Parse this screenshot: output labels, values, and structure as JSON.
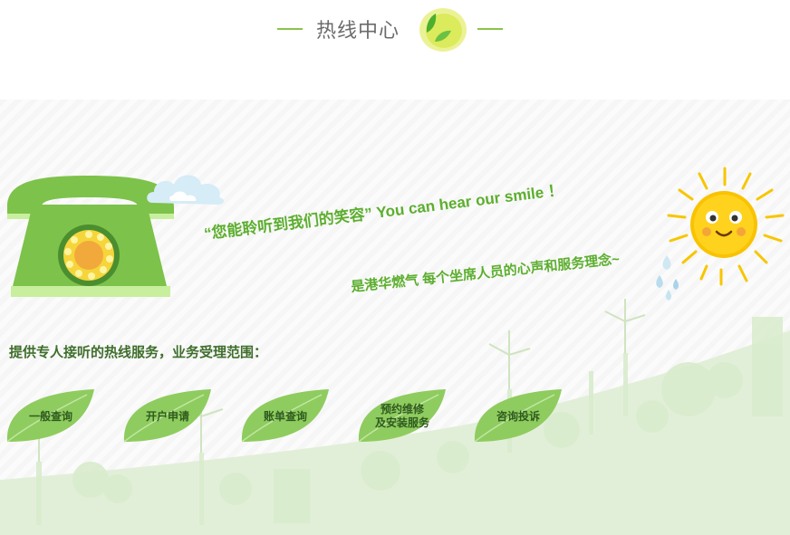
{
  "header": {
    "title": "热线中心"
  },
  "slogan": {
    "line1": "“您能聆听到我们的笑容” You can hear our smile ！",
    "line2": "是港华燃气 每个坐席人员的心声和服务理念~"
  },
  "intro": "提供专人接听的热线服务，业务受理范围：",
  "services": [
    {
      "line1": "一般查询",
      "line2": ""
    },
    {
      "line1": "开户申请",
      "line2": ""
    },
    {
      "line1": "账单查询",
      "line2": ""
    },
    {
      "line1": "预约维修",
      "line2": "及安装服务"
    },
    {
      "line1": "咨询投诉",
      "line2": ""
    }
  ],
  "colors": {
    "accent": "#8bc34a",
    "dark_green": "#3f6e2c",
    "leaf": "#8fcc5f",
    "sun": "#f7b500"
  },
  "icons": [
    "telephone-icon",
    "sun-icon",
    "leaf-icon",
    "cloud-icon"
  ]
}
